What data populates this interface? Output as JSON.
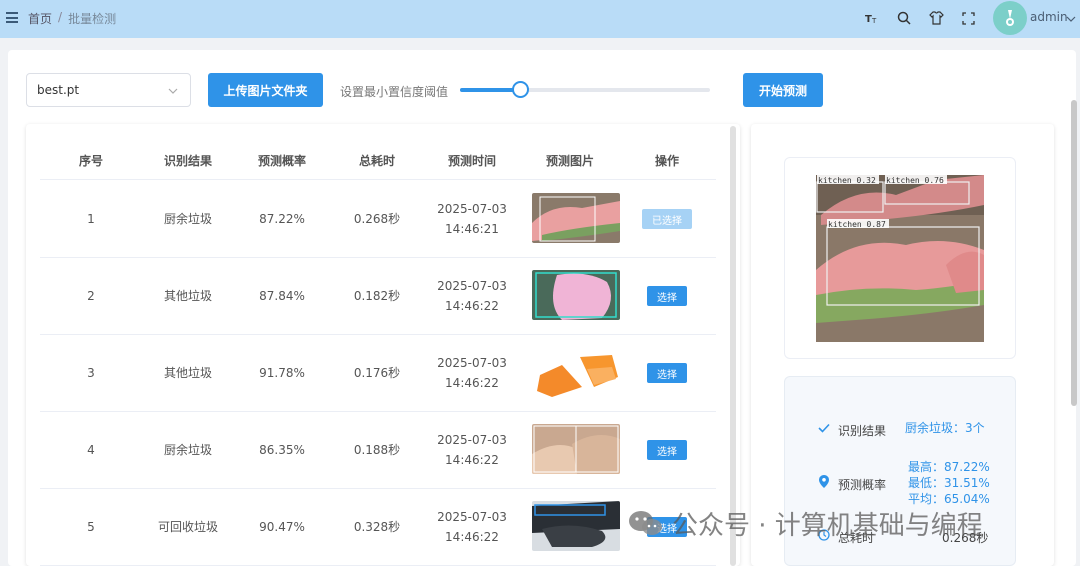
{
  "breadcrumb": {
    "home": "首页",
    "separator": "/",
    "current": "批量检测"
  },
  "header": {
    "icons": [
      "font-size-icon",
      "search-icon",
      "shirt-icon",
      "fullscreen-icon"
    ],
    "user": "admin"
  },
  "controls": {
    "model_select": "best.pt",
    "upload_button": "上传图片文件夹",
    "threshold_label": "设置最小置信度阈值",
    "threshold_value": 0.24,
    "predict_button": "开始预测"
  },
  "table": {
    "headers": [
      "序号",
      "识别结果",
      "预测概率",
      "总耗时",
      "预测时间",
      "预测图片",
      "操作"
    ],
    "rows": [
      {
        "index": "1",
        "result": "厨余垃圾",
        "prob": "87.22%",
        "time": "0.268秒",
        "date": "2025-07-03",
        "clock": "14:46:21",
        "action": "已选择",
        "selected": true
      },
      {
        "index": "2",
        "result": "其他垃圾",
        "prob": "87.84%",
        "time": "0.182秒",
        "date": "2025-07-03",
        "clock": "14:46:22",
        "action": "选择",
        "selected": false
      },
      {
        "index": "3",
        "result": "其他垃圾",
        "prob": "91.78%",
        "time": "0.176秒",
        "date": "2025-07-03",
        "clock": "14:46:22",
        "action": "选择",
        "selected": false
      },
      {
        "index": "4",
        "result": "厨余垃圾",
        "prob": "86.35%",
        "time": "0.188秒",
        "date": "2025-07-03",
        "clock": "14:46:22",
        "action": "选择",
        "selected": false
      },
      {
        "index": "5",
        "result": "可回收垃圾",
        "prob": "90.47%",
        "time": "0.328秒",
        "date": "2025-07-03",
        "clock": "14:46:22",
        "action": "选择",
        "selected": false
      }
    ]
  },
  "preview": {
    "detections": [
      "kitchen 0.32",
      "kitchen 0.76",
      "kitchen 0.87"
    ]
  },
  "summary": {
    "result_label": "识别结果",
    "result_value": "厨余垃圾：3个",
    "prob_label": "预测概率",
    "prob_max": "最高：87.22%",
    "prob_min": "最低：31.51%",
    "prob_avg": "平均：65.04%",
    "time_label": "总耗时",
    "time_value": "0.268秒"
  },
  "watermark": "公众号 · 计算机基础与编程",
  "colors": {
    "primary": "#2f93e8",
    "topbar": "#b9dcf7",
    "primary_light": "#a6d2f5"
  }
}
